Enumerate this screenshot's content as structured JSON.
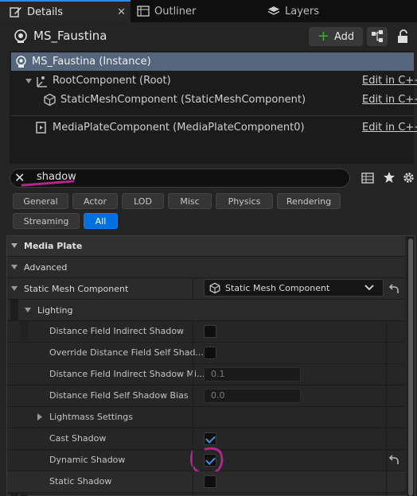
{
  "tabs": [
    {
      "label": "Details",
      "icon": "details-pencil-icon",
      "active": true
    },
    {
      "label": "Outliner",
      "icon": "outliner-icon",
      "active": false
    },
    {
      "label": "Layers",
      "icon": "layers-icon",
      "active": false
    }
  ],
  "tab_close": "✕",
  "header": {
    "title": "MS_Faustina",
    "add_label": "Add"
  },
  "components": {
    "instance": "MS_Faustina (Instance)",
    "root": "RootComponent (Root)",
    "static_mesh": "StaticMeshComponent (StaticMeshComponent)",
    "media_plate": "MediaPlateComponent (MediaPlateComponent0)",
    "edit_link": "Edit in C++"
  },
  "search": {
    "value": "shadow",
    "clear_glyph": "✕"
  },
  "filters": [
    "General",
    "Actor",
    "LOD",
    "Misc",
    "Physics",
    "Rendering",
    "Streaming",
    "All"
  ],
  "active_filter": "All",
  "details": {
    "media_plate": "Media Plate",
    "advanced": "Advanced",
    "static_mesh_component": "Static Mesh Component",
    "static_mesh_dropdown": "Static Mesh Component",
    "lighting": "Lighting",
    "props": {
      "df_indirect_shadow": "Distance Field Indirect Shadow",
      "override_df_self": "Override Distance Field Self Shad...",
      "df_indirect_min": "Distance Field Indirect Shadow Mi...",
      "df_indirect_min_value": "0.1",
      "df_self_bias": "Distance Field Self Shadow Bias",
      "df_self_bias_value": "0.0",
      "lightmass": "Lightmass Settings",
      "cast_shadow": "Cast Shadow",
      "dynamic_shadow": "Dynamic Shadow",
      "static_shadow": "Static Shadow"
    },
    "checks": {
      "df_indirect_shadow": false,
      "override_df_self": false,
      "cast_shadow": true,
      "dynamic_shadow": true,
      "static_shadow": false
    }
  },
  "colors": {
    "accent": "#0070e0",
    "annotation": "#b0278a",
    "add_green": "#35b335",
    "selection": "#55657b"
  }
}
